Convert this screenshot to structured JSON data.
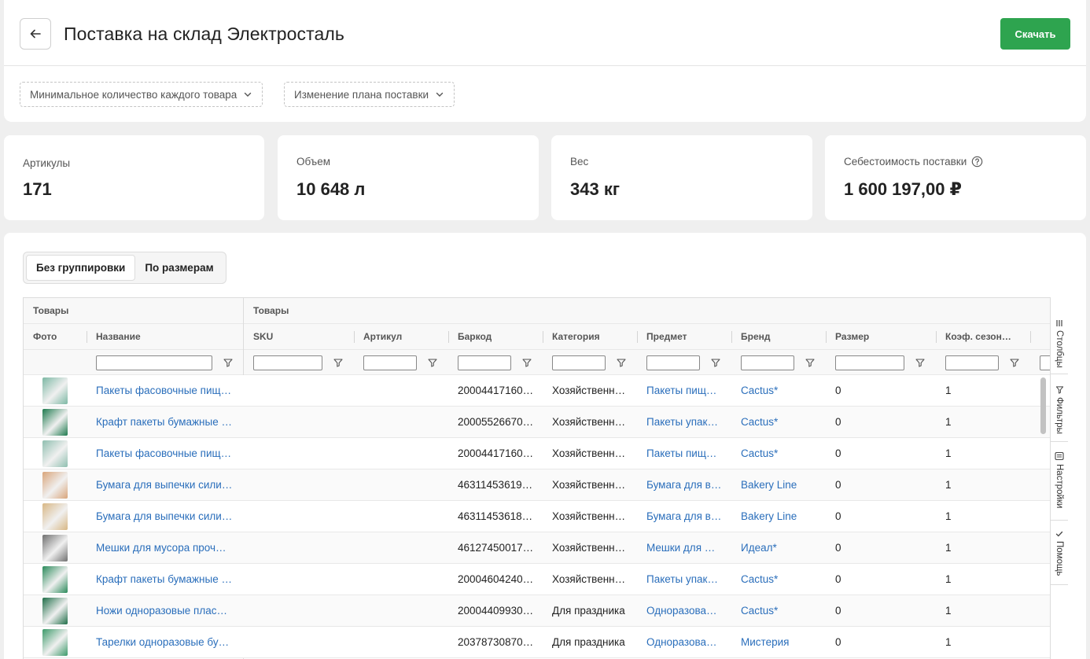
{
  "header": {
    "title": "Поставка на склад Электросталь",
    "download_label": "Скачать",
    "filters": [
      "Минимальное количество каждого товара",
      "Изменение плана поставки"
    ]
  },
  "stats": [
    {
      "label": "Артикулы",
      "value": "171"
    },
    {
      "label": "Объем",
      "value": "10 648 л"
    },
    {
      "label": "Вес",
      "value": "343 кг"
    },
    {
      "label": "Себестоимость поставки",
      "value": "1 600 197,00 ₽"
    }
  ],
  "grouping": {
    "options": [
      "Без группировки",
      "По размерам"
    ],
    "active": 0
  },
  "table": {
    "groups": [
      "Товары",
      "Товары"
    ],
    "columns": [
      "Фото",
      "Название",
      "SKU",
      "Артикул",
      "Баркод",
      "Категория",
      "Предмет",
      "Бренд",
      "Размер",
      "Коэф. сезон…"
    ],
    "rows": [
      {
        "name": "Пакеты фасовочные пищ…",
        "sku": "",
        "article": "",
        "barcode": "20004417160…",
        "category": "Хозяйственн…",
        "subject": "Пакеты пищ…",
        "brand": "Cactus*",
        "size": "0",
        "season": "1",
        "thumb": "#7cb8a4"
      },
      {
        "name": "Крафт пакеты бумажные …",
        "sku": "",
        "article": "",
        "barcode": "20005526670…",
        "category": "Хозяйственн…",
        "subject": "Пакеты упак…",
        "brand": "Cactus*",
        "size": "0",
        "season": "1",
        "thumb": "#1e7a4e"
      },
      {
        "name": "Пакеты фасовочные пищ…",
        "sku": "",
        "article": "",
        "barcode": "20004417160…",
        "category": "Хозяйственн…",
        "subject": "Пакеты пищ…",
        "brand": "Cactus*",
        "size": "0",
        "season": "1",
        "thumb": "#8fbfb0"
      },
      {
        "name": "Бумага для выпечки сили…",
        "sku": "",
        "article": "",
        "barcode": "46311453619…",
        "category": "Хозяйственн…",
        "subject": "Бумага для в…",
        "brand": "Bakery Line",
        "size": "0",
        "season": "1",
        "thumb": "#d9a57a"
      },
      {
        "name": "Бумага для выпечки сили…",
        "sku": "",
        "article": "",
        "barcode": "46311453618…",
        "category": "Хозяйственн…",
        "subject": "Бумага для в…",
        "brand": "Bakery Line",
        "size": "0",
        "season": "1",
        "thumb": "#d8b784"
      },
      {
        "name": "Мешки для мусора проч…",
        "sku": "",
        "article": "",
        "barcode": "46127450017…",
        "category": "Хозяйственн…",
        "subject": "Мешки для …",
        "brand": "Идеал*",
        "size": "0",
        "season": "1",
        "thumb": "#707070"
      },
      {
        "name": "Крафт пакеты бумажные …",
        "sku": "",
        "article": "",
        "barcode": "20004604240…",
        "category": "Хозяйственн…",
        "subject": "Пакеты упак…",
        "brand": "Cactus*",
        "size": "0",
        "season": "1",
        "thumb": "#2a8a5a"
      },
      {
        "name": "Ножи одноразовые плас…",
        "sku": "",
        "article": "",
        "barcode": "20004409930…",
        "category": "Для праздника",
        "subject": "Одноразова…",
        "brand": "Cactus*",
        "size": "0",
        "season": "1",
        "thumb": "#1f6e48"
      },
      {
        "name": "Тарелки одноразовые бу…",
        "sku": "",
        "article": "",
        "barcode": "20378730870…",
        "category": "Для праздника",
        "subject": "Одноразова…",
        "brand": "Мистерия",
        "size": "0",
        "season": "1",
        "thumb": "#3c9a6a"
      }
    ]
  },
  "side_tabs": [
    "Столбцы",
    "Фильтры",
    "Настройки",
    "Помощь"
  ],
  "colors": {
    "accent": "#2ea44f",
    "link": "#2a6ebb"
  }
}
